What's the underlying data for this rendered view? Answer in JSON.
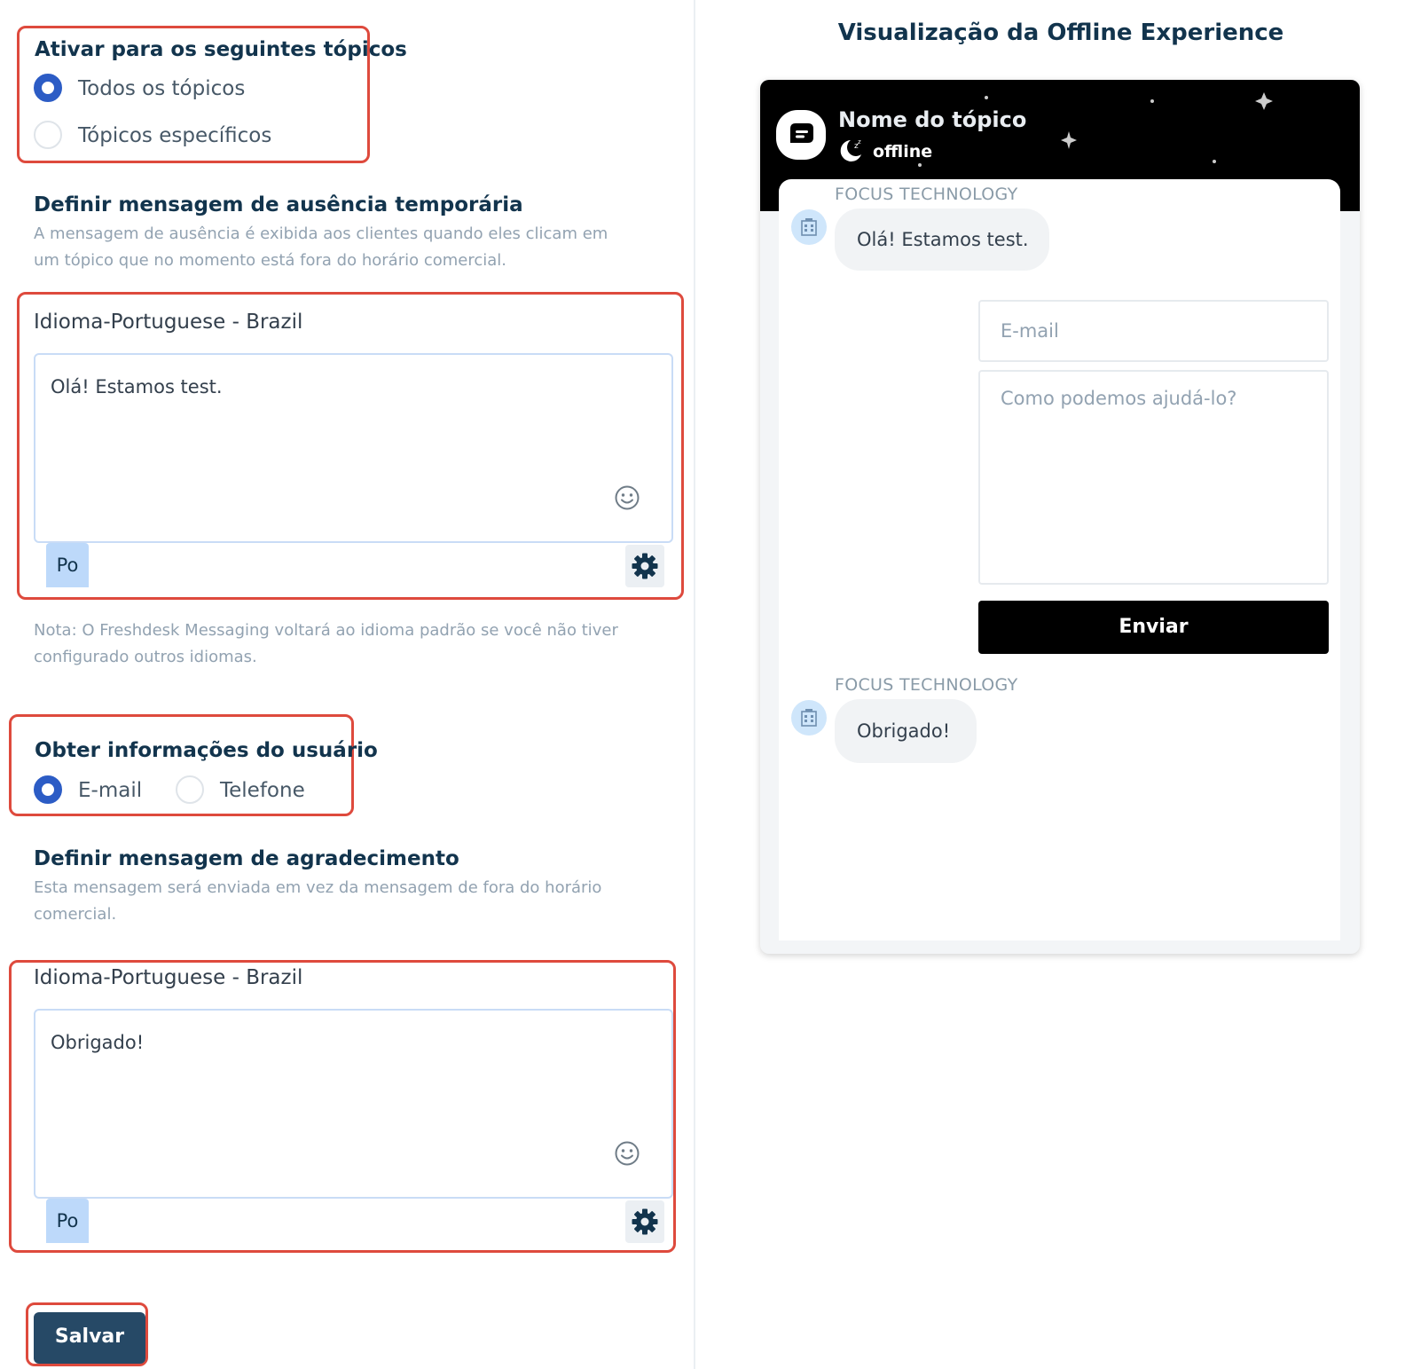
{
  "topics": {
    "heading": "Ativar para os seguintes tópicos",
    "options": [
      {
        "label": "Todos os tópicos",
        "selected": true
      },
      {
        "label": "Tópicos específicos",
        "selected": false
      }
    ]
  },
  "away": {
    "heading": "Definir mensagem de ausência temporária",
    "description_line1": "A mensagem de ausência é exibida aos clientes quando eles clicam em",
    "description_line2": "um tópico que no momento está fora do horário comercial.",
    "language_label": "Idioma-Portuguese - Brazil",
    "message": "Olá! Estamos test.",
    "language_chip": "Po",
    "note_line1": "Nota: O Freshdesk Messaging voltará ao idioma padrão se você não tiver",
    "note_line2": "configurado outros idiomas."
  },
  "user_info": {
    "heading": "Obter informações do usuário",
    "options": [
      {
        "label": "E-mail",
        "selected": true
      },
      {
        "label": "Telefone",
        "selected": false
      }
    ]
  },
  "thanks": {
    "heading": "Definir mensagem de agradecimento",
    "description_line1": "Esta mensagem será enviada em vez da mensagem de fora do horário",
    "description_line2": "comercial.",
    "language_label": "Idioma-Portuguese - Brazil",
    "message": "Obrigado!",
    "language_chip": "Po"
  },
  "save_label": "Salvar",
  "preview": {
    "title": "Visualização da Offline Experience",
    "topic_name": "Nome do tópico",
    "status": "offline",
    "agent_name": "FOCUS TECHNOLOGY",
    "away_message": "Olá! Estamos test.",
    "email_placeholder": "E-mail",
    "help_placeholder": "Como podemos ajudá-lo?",
    "send_label": "Enviar",
    "thanks_message": "Obrigado!"
  },
  "colors": {
    "highlight": "#de4a3d",
    "radio_selected": "#2c5cc5",
    "primary_button": "#264966",
    "chip": "#bdd9fa"
  }
}
